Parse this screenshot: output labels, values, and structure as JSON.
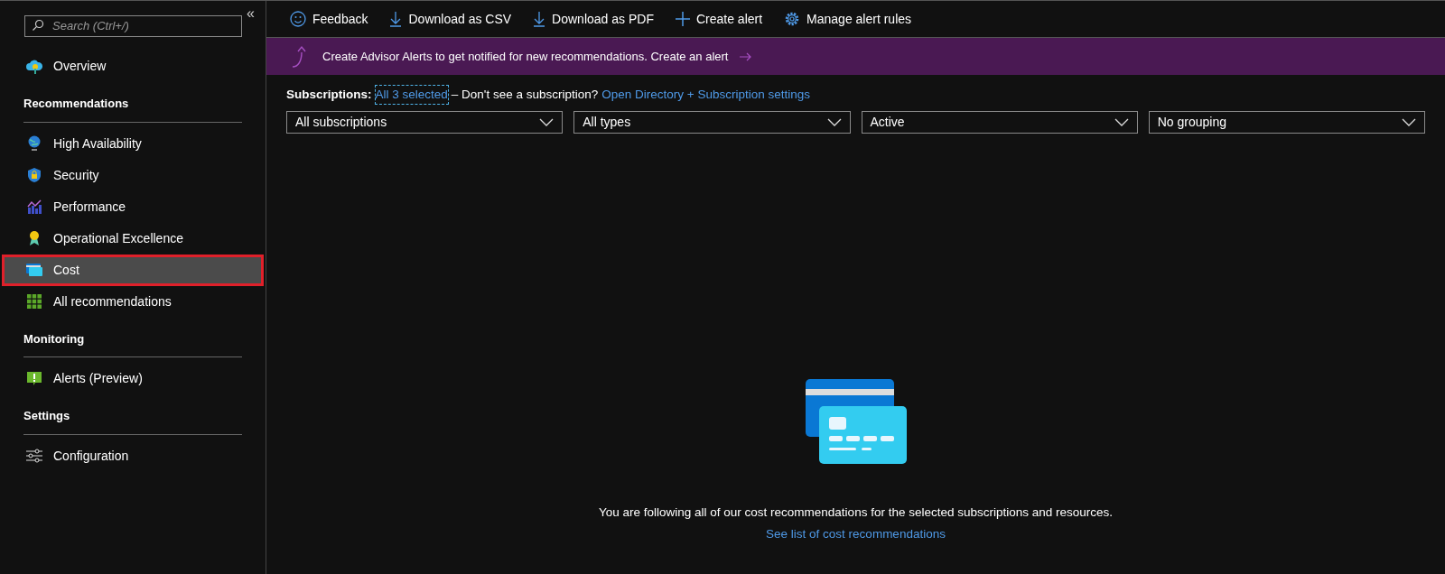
{
  "sidebar": {
    "search": {
      "placeholder": "Search (Ctrl+/)"
    },
    "collapse_glyph": "«",
    "items": [
      {
        "kind": "link",
        "label": "Overview",
        "selected": false
      },
      {
        "kind": "header",
        "label": "Recommendations"
      },
      {
        "kind": "link",
        "label": "High Availability",
        "selected": false
      },
      {
        "kind": "link",
        "label": "Security",
        "selected": false
      },
      {
        "kind": "link",
        "label": "Performance",
        "selected": false
      },
      {
        "kind": "link",
        "label": "Operational Excellence",
        "selected": false
      },
      {
        "kind": "link",
        "label": "Cost",
        "selected": true
      },
      {
        "kind": "link",
        "label": "All recommendations",
        "selected": false
      },
      {
        "kind": "header",
        "label": "Monitoring"
      },
      {
        "kind": "link",
        "label": "Alerts (Preview)",
        "selected": false
      },
      {
        "kind": "header",
        "label": "Settings"
      },
      {
        "kind": "link",
        "label": "Configuration",
        "selected": false
      }
    ]
  },
  "toolbar": [
    "Feedback",
    "Download as CSV",
    "Download as PDF",
    "Create alert",
    "Manage alert rules"
  ],
  "banner": {
    "text": "Create Advisor Alerts to get notified for new recommendations. Create an alert"
  },
  "subscriptions": {
    "label": "Subscriptions:",
    "selection_link": "All 3 selected",
    "text": "– Don't see a subscription?",
    "settings_link": "Open Directory + Subscription settings"
  },
  "filters": [
    "All subscriptions",
    "All types",
    "Active",
    "No grouping"
  ],
  "empty_state": {
    "message": "You are following all of our cost recommendations for the selected subscriptions and resources.",
    "link": "See list of cost recommendations"
  }
}
